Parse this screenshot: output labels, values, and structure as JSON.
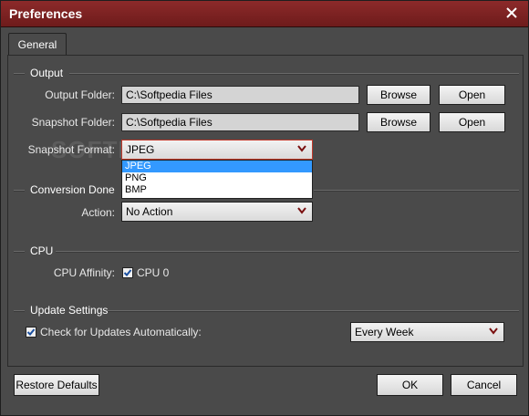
{
  "window": {
    "title": "Preferences"
  },
  "tabs": [
    {
      "label": "General"
    }
  ],
  "output": {
    "section_label": "Output",
    "output_folder_label": "Output Folder:",
    "output_folder_value": "C:\\Softpedia Files",
    "snapshot_folder_label": "Snapshot Folder:",
    "snapshot_folder_value": "C:\\Softpedia Files",
    "browse_label": "Browse",
    "open_label": "Open",
    "snapshot_format_label": "Snapshot Format:",
    "snapshot_format_value": "JPEG",
    "snapshot_format_options": [
      "JPEG",
      "PNG",
      "BMP"
    ]
  },
  "conversion": {
    "section_label": "Conversion Done",
    "action_label": "Action:",
    "action_value": "No Action"
  },
  "cpu": {
    "section_label": "CPU",
    "affinity_label": "CPU Affinity:",
    "cpu0_label": "CPU 0",
    "cpu0_checked": true
  },
  "update": {
    "section_label": "Update Settings",
    "check_label": "Check for Updates Automatically:",
    "check_checked": true,
    "frequency_value": "Every Week"
  },
  "footer": {
    "restore_label": "Restore Defaults",
    "ok_label": "OK",
    "cancel_label": "Cancel"
  },
  "watermark": "SOFTPEDIA",
  "colors": {
    "titlebar": "#7a2020",
    "selection": "#3399ff",
    "focus_border": "#c0392b"
  },
  "icons": {
    "close": "close-icon",
    "check": "checkmark-icon",
    "dropdown": "chevron-down-icon"
  }
}
